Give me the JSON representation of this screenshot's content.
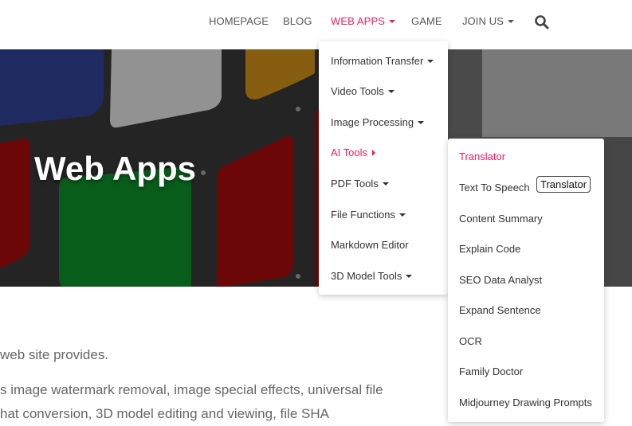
{
  "nav": {
    "items": [
      {
        "label": "HOMEPAGE",
        "has_caret": false
      },
      {
        "label": "BLOG",
        "has_caret": false
      },
      {
        "label": "WEB APPS",
        "has_caret": true,
        "active": true
      },
      {
        "label": "GAME",
        "has_caret": false
      },
      {
        "label": "JOIN US",
        "has_caret": true
      }
    ],
    "search_icon": "search-icon",
    "accent_color": "#e91e63"
  },
  "hero": {
    "title": "Web Apps"
  },
  "web_apps_menu": {
    "items": [
      {
        "label": "Information Transfer",
        "submenu": "down"
      },
      {
        "label": "Video Tools",
        "submenu": "down"
      },
      {
        "label": "Image Processing",
        "submenu": "down"
      },
      {
        "label": "AI Tools",
        "submenu": "right",
        "active": true
      },
      {
        "label": "PDF Tools",
        "submenu": "down"
      },
      {
        "label": "File Functions",
        "submenu": "down"
      },
      {
        "label": "Markdown Editor"
      },
      {
        "label": "3D Model Tools",
        "submenu": "down"
      }
    ]
  },
  "ai_tools_menu": {
    "items": [
      {
        "label": "Translator",
        "active": true
      },
      {
        "label": "Text To Speech"
      },
      {
        "label": "Content Summary"
      },
      {
        "label": "Explain Code"
      },
      {
        "label": "SEO Data Analyst"
      },
      {
        "label": "Expand Sentence"
      },
      {
        "label": "OCR"
      },
      {
        "label": "Family Doctor"
      },
      {
        "label": "Midjourney Drawing Prompts"
      }
    ]
  },
  "tooltip": {
    "text": "Translator"
  },
  "body_text": {
    "line1": "web site provides.",
    "line2": "s image watermark removal, image special effects, universal file",
    "line3": "hat conversion, 3D model editing and viewing, file SHA"
  }
}
